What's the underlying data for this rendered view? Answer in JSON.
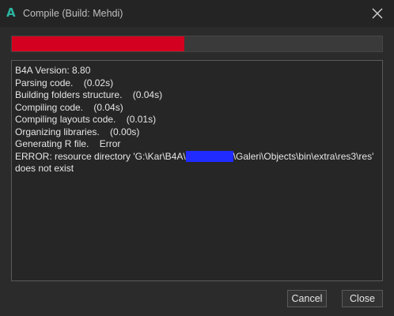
{
  "window": {
    "app_icon_glyph": "A",
    "title": "Compile (Build: Mehdi)",
    "close_icon": "close-icon"
  },
  "progress": {
    "fraction": 0.465,
    "fill_color": "#d4001f"
  },
  "log": {
    "lines": [
      "B4A Version: 8.80",
      "Parsing code.    (0.02s)",
      "Building folders structure.    (0.04s)",
      "Compiling code.    (0.04s)",
      "Compiling layouts code.    (0.01s)",
      "Organizing libraries.    (0.00s)",
      "Generating R file.    Error"
    ],
    "error_prefix": "ERROR: resource directory 'G:\\Kar\\B4A\\",
    "error_suffix": "\\Galeri\\Objects\\bin\\extra\\res3\\res'",
    "error_line2": "does not exist"
  },
  "buttons": {
    "cancel": "Cancel",
    "close": "Close"
  },
  "colors": {
    "background": "#2b2b2b",
    "accent": "#2bb3a0",
    "redaction": "#1f2bff"
  }
}
